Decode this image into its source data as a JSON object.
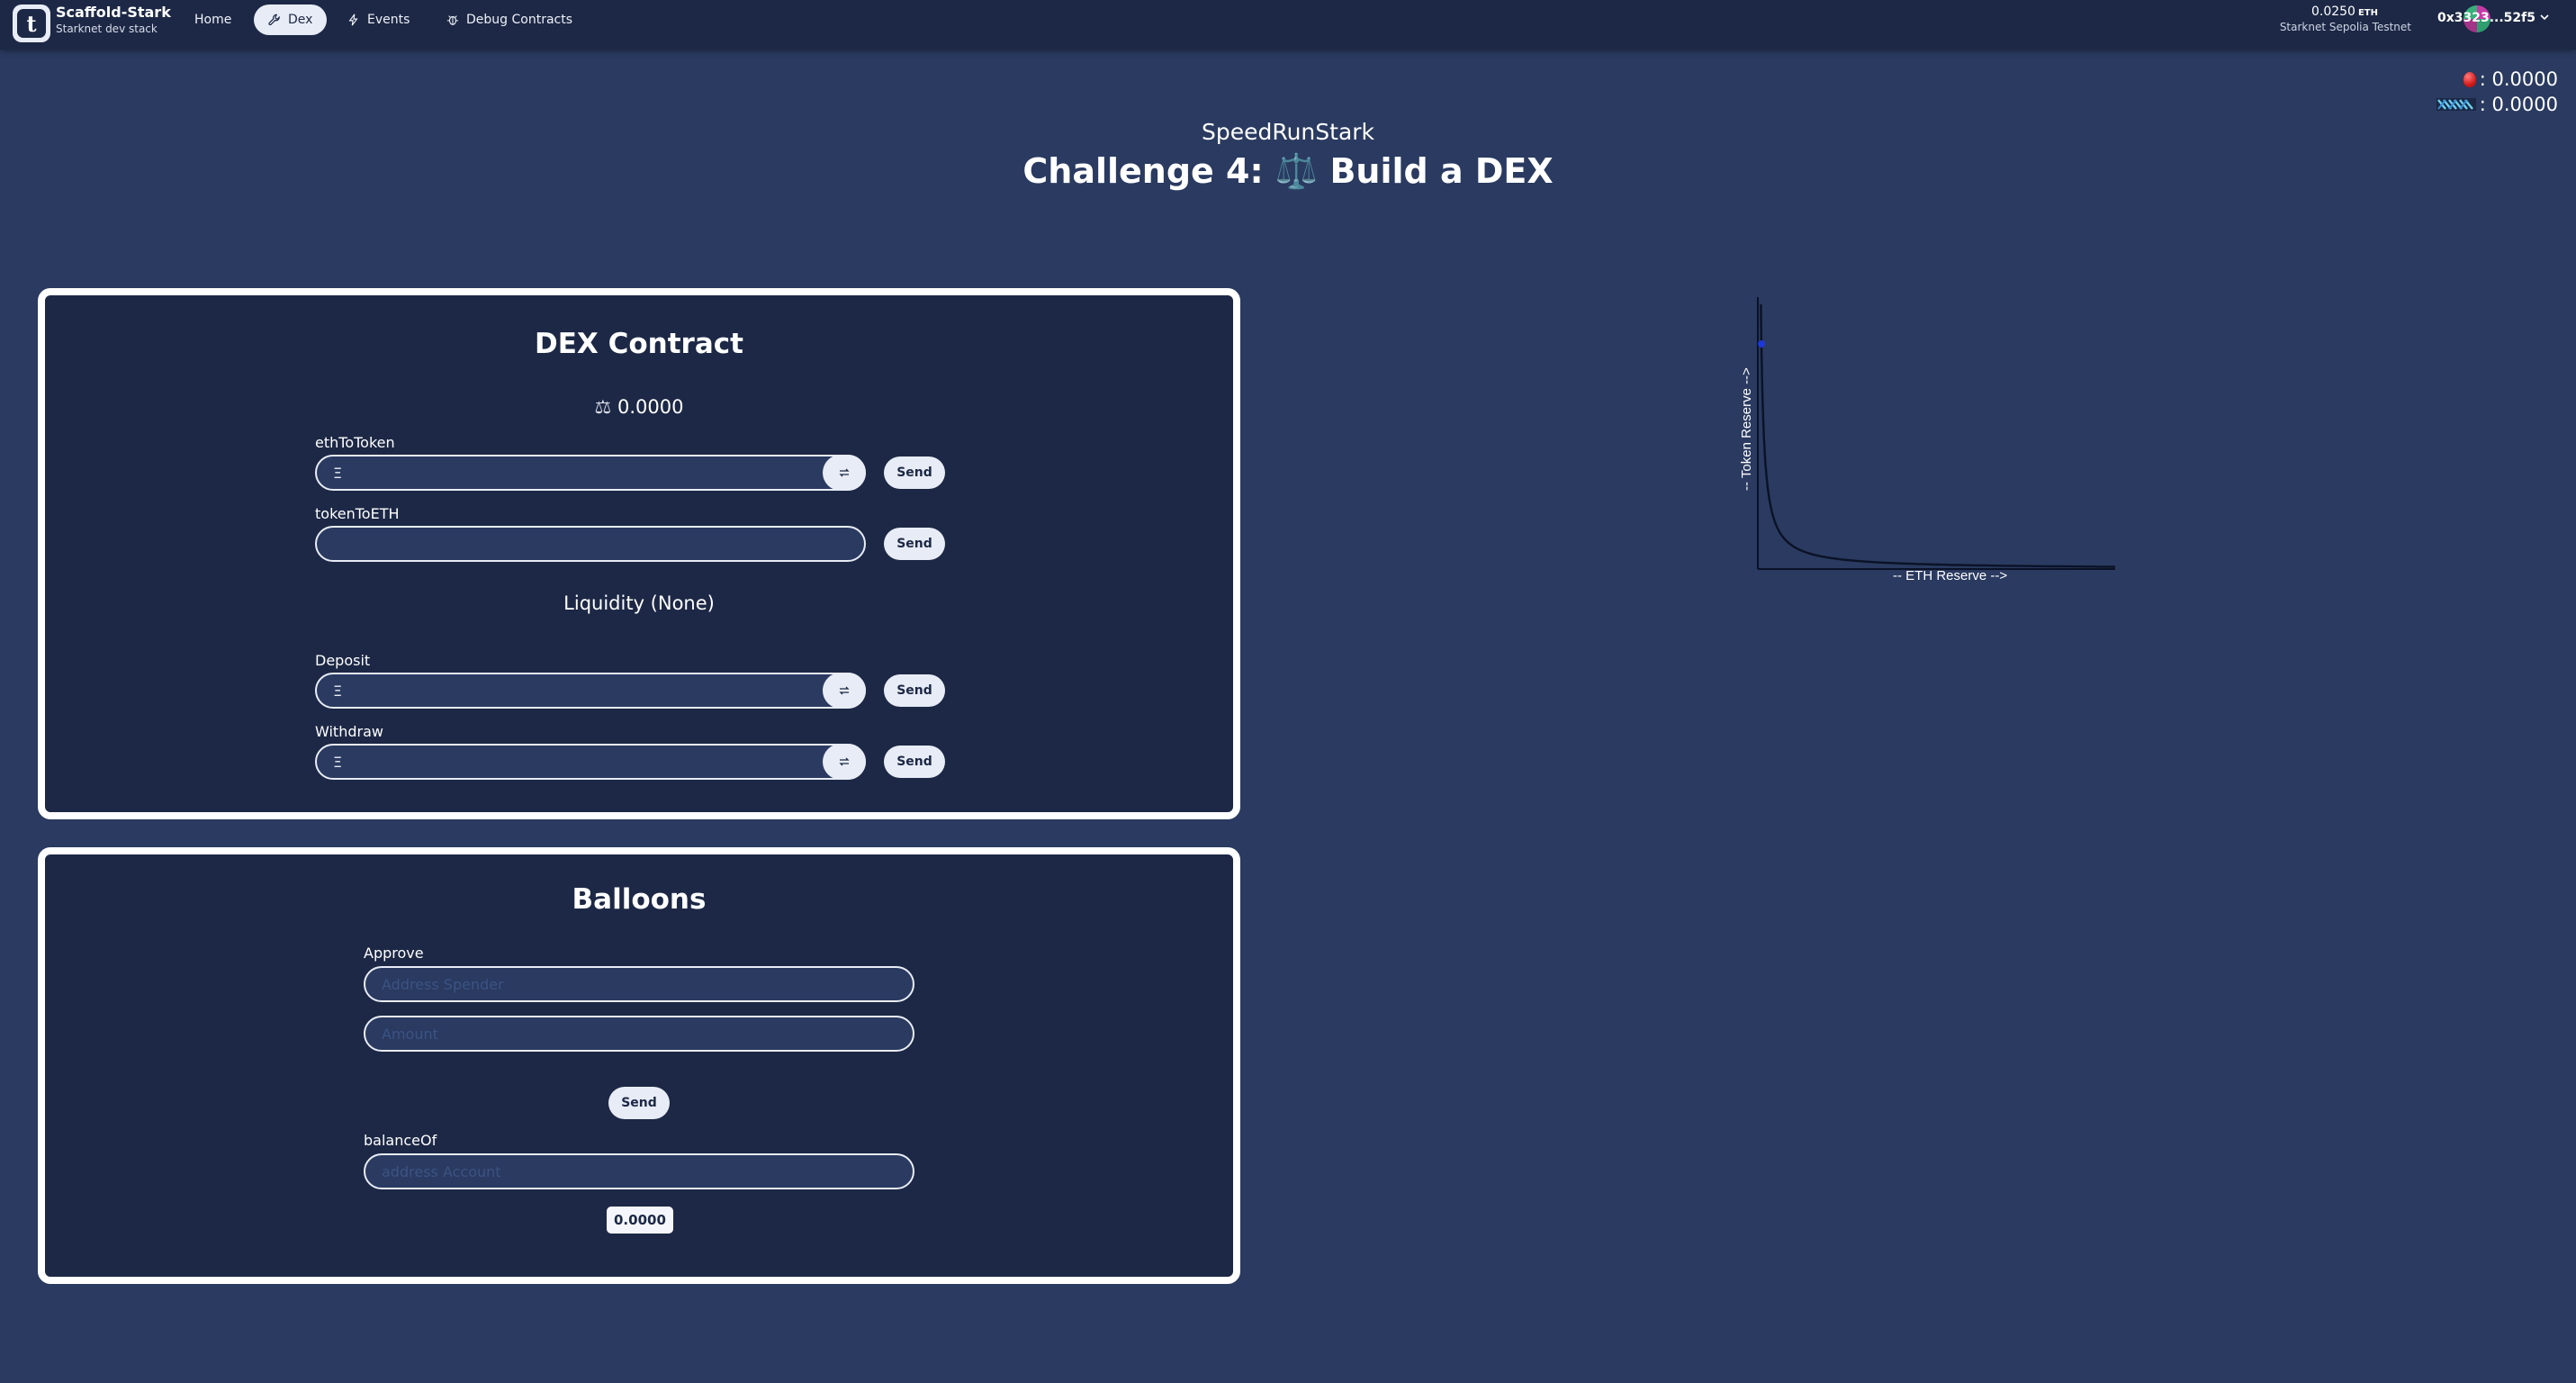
{
  "navbar": {
    "brand_title": "Scaffold-Stark",
    "brand_sub": "Starknet dev stack",
    "items": [
      {
        "label": "Home",
        "icon": "none"
      },
      {
        "label": "Dex",
        "icon": "wrench-icon"
      },
      {
        "label": "Events",
        "icon": "bolt-icon"
      },
      {
        "label": "Debug Contracts",
        "icon": "bug-icon"
      }
    ],
    "eth_balance": "0.0250",
    "eth_unit": "ETH",
    "network": "Starknet Sepolia Testnet",
    "address": "0x3323...52f5"
  },
  "balances": {
    "balloons": ": 0.0000",
    "strk": ": 0.0000"
  },
  "header": {
    "subtitle": "SpeedRunStark",
    "title": "Challenge 4: ⚖️ Build a DEX"
  },
  "dex": {
    "title": "DEX Contract",
    "balance": "0.0000",
    "eth_to_token_label": "ethToToken",
    "token_to_eth_label": "tokenToETH",
    "eth_symbol": "Ξ",
    "send_label": "Send",
    "liquidity_label": "Liquidity (None)",
    "deposit_label": "Deposit",
    "withdraw_label": "Withdraw"
  },
  "balloons_card": {
    "title": "Balloons",
    "approve_label": "Approve",
    "spender_placeholder": "Address Spender",
    "amount_placeholder": "Amount",
    "send_label": "Send",
    "balance_of_label": "balanceOf",
    "account_placeholder": "address Account",
    "balance_value": "0.0000"
  },
  "chart_data": {
    "type": "line",
    "xlabel": "-- ETH Reserve -->",
    "ylabel": "-- Token Reserve -->",
    "curve_k": 1,
    "point": {
      "x": 0.1,
      "y": 10
    }
  },
  "colors": {
    "background": "#2a3a60",
    "navbar": "#1c2845",
    "card": "#1c2845",
    "accent": "#e8ecf6"
  }
}
